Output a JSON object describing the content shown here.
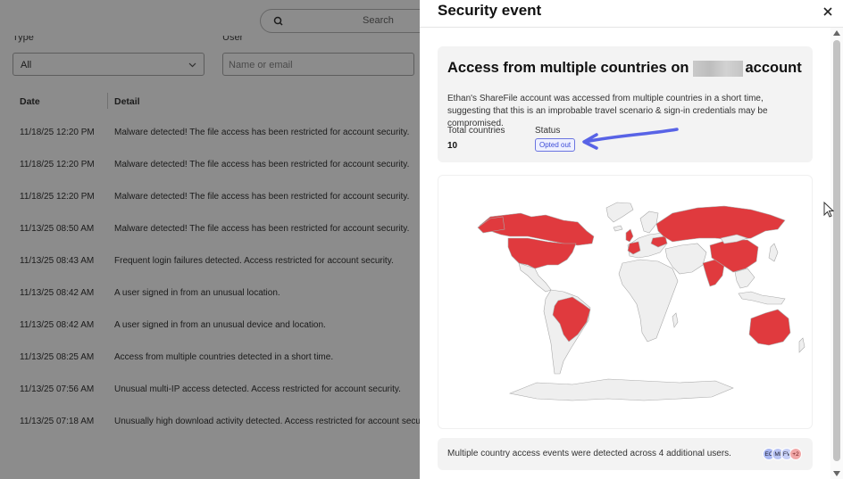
{
  "background": {
    "search_placeholder": "Search",
    "filter_type_label": "Type",
    "filter_user_label": "User",
    "type_select_value": "All",
    "user_input_placeholder": "Name or email",
    "columns": [
      "Date",
      "Detail"
    ],
    "rows": [
      {
        "date": "11/18/25 12:20 PM",
        "detail": "Malware detected! The file access has been restricted for account security."
      },
      {
        "date": "11/18/25 12:20 PM",
        "detail": "Malware detected! The file access has been restricted for account security."
      },
      {
        "date": "11/18/25 12:20 PM",
        "detail": "Malware detected! The file access has been restricted for account security."
      },
      {
        "date": "11/13/25 08:50 AM",
        "detail": "Malware detected! The file access has been restricted for account security."
      },
      {
        "date": "11/13/25 08:43 AM",
        "detail": "Frequent login failures detected. Access restricted for account security."
      },
      {
        "date": "11/13/25 08:42 AM",
        "detail": "A user signed in from an unusual location."
      },
      {
        "date": "11/13/25 08:42 AM",
        "detail": "A user signed in from an unusual device and location."
      },
      {
        "date": "11/13/25 08:25 AM",
        "detail": "Access from multiple countries detected in a short time."
      },
      {
        "date": "11/13/25 07:56 AM",
        "detail": "Unusual multi-IP access detected. Access restricted for account security."
      },
      {
        "date": "11/13/25 07:18 AM",
        "detail": "Unusually high download activity detected. Access restricted for account security."
      }
    ]
  },
  "panel": {
    "title": "Security event",
    "close_icon": "close-icon",
    "event": {
      "title_prefix": "Access from multiple countries on",
      "title_suffix": "account",
      "description": "Ethan's ShareFile account was accessed from multiple countries in a short time, suggesting that this is an improbable travel scenario & sign-in credentials may be compromised.",
      "total_countries_label": "Total countries",
      "total_countries_value": "10",
      "status_label": "Status",
      "status_value": "Opted out"
    },
    "map": {
      "highlight_color": "#e03a3e",
      "land_color": "#efefef",
      "highlighted_regions": [
        "United States",
        "Canada",
        "Brazil",
        "United Kingdom",
        "France",
        "Ukraine",
        "Russia",
        "China",
        "India",
        "Australia"
      ]
    },
    "footer": {
      "text": "Multiple country access events were detected across 4 additional users.",
      "avatars": [
        "EC",
        "MI",
        "FV"
      ],
      "more_count": "+2"
    }
  },
  "colors": {
    "accent": "#3b4bd8",
    "arrow": "#5863e6",
    "map_red": "#e03a3e"
  }
}
